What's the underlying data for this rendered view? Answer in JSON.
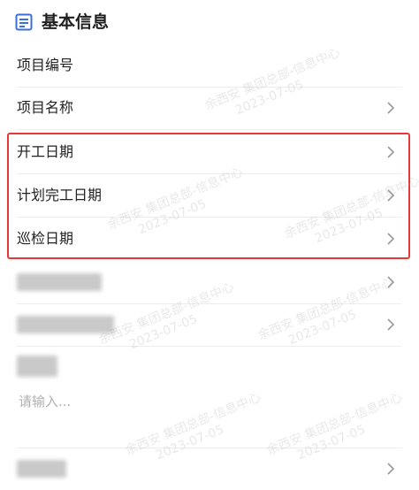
{
  "section": {
    "title": "基本信息",
    "icon": "document-icon"
  },
  "rows": [
    {
      "label": "项目编号",
      "has_chevron": false
    },
    {
      "label": "项目名称",
      "has_chevron": true
    },
    {
      "label": "开工日期",
      "has_chevron": true
    },
    {
      "label": "计划完工日期",
      "has_chevron": true
    },
    {
      "label": "巡检日期",
      "has_chevron": true
    }
  ],
  "text_input": {
    "placeholder": "请输入..."
  },
  "watermark": {
    "name": "余西安 集团总部-信息中心",
    "date": "2023-07-05"
  },
  "colors": {
    "accent": "#3a6fe0",
    "highlight": "#e53935",
    "chevron": "#999999"
  }
}
